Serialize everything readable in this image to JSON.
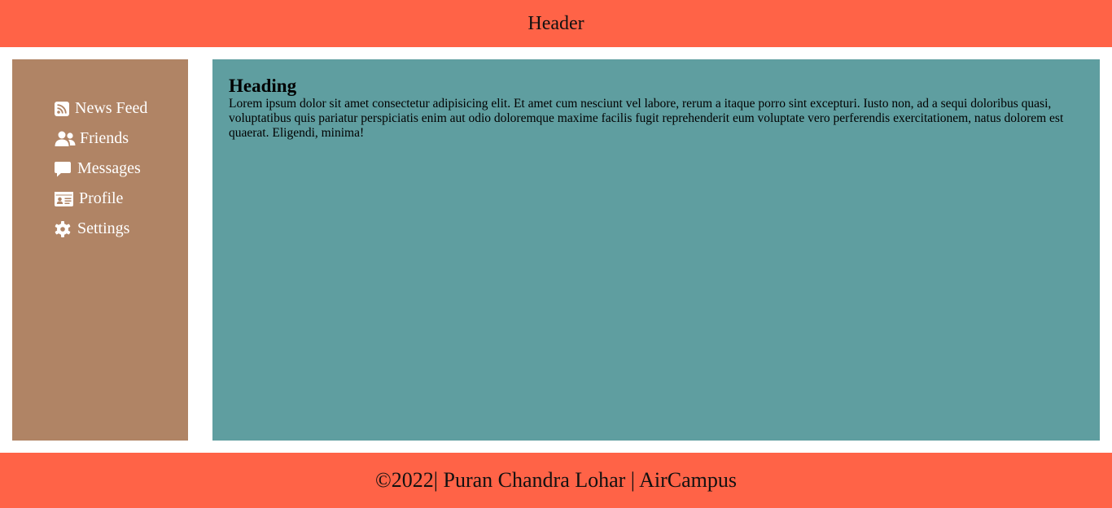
{
  "header": {
    "title": "Header"
  },
  "sidebar": {
    "items": [
      {
        "label": "News Feed",
        "icon": "rss-icon"
      },
      {
        "label": "Friends",
        "icon": "users-icon"
      },
      {
        "label": "Messages",
        "icon": "message-icon"
      },
      {
        "label": "Profile",
        "icon": "id-card-icon"
      },
      {
        "label": "Settings",
        "icon": "gear-icon"
      }
    ]
  },
  "main": {
    "heading": "Heading",
    "body": "Lorem ipsum dolor sit amet consectetur adipisicing elit. Et amet cum nesciunt vel labore, rerum a itaque porro sint excepturi. Iusto non, ad a sequi doloribus quasi, voluptatibus quis pariatur perspiciatis enim aut odio doloremque maxime facilis fugit reprehenderit eum voluptate vero perferendis exercitationem, natus dolorem est quaerat. Eligendi, minima!"
  },
  "footer": {
    "text": "©2022| Puran Chandra Lohar | AirCampus"
  },
  "colors": {
    "header_bg": "#ff6347",
    "sidebar_bg": "#b08465",
    "main_bg": "#5f9ea0",
    "footer_bg": "#ff6347"
  }
}
